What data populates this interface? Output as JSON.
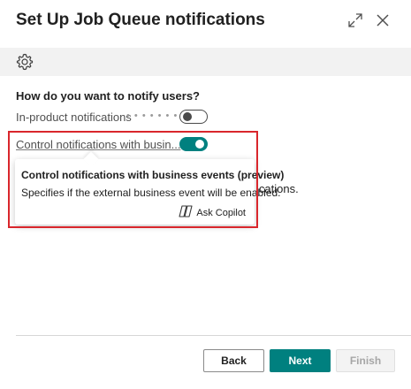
{
  "dialog": {
    "title": "Set Up Job Queue notifications",
    "expand_icon": "expand-icon",
    "close_icon": "close-icon"
  },
  "toolbar": {
    "settings_icon": "gear-icon"
  },
  "content": {
    "question": "How do you want to notify users?",
    "fields": [
      {
        "label": "In-product notifications",
        "toggle_on": false
      },
      {
        "label": "Control notifications with busin...",
        "toggle_on": true
      }
    ],
    "partially_hidden_text": "ications."
  },
  "tooltip": {
    "title": "Control notifications with business events (preview)",
    "description": "Specifies if the external business event will be enabled.",
    "ask_copilot": "Ask Copilot",
    "copilot_icon": "copilot-icon"
  },
  "footer": {
    "back_label": "Back",
    "next_label": "Next",
    "finish_label": "Finish"
  },
  "colors": {
    "accent": "#00807f",
    "highlight_border": "#d9262c"
  }
}
